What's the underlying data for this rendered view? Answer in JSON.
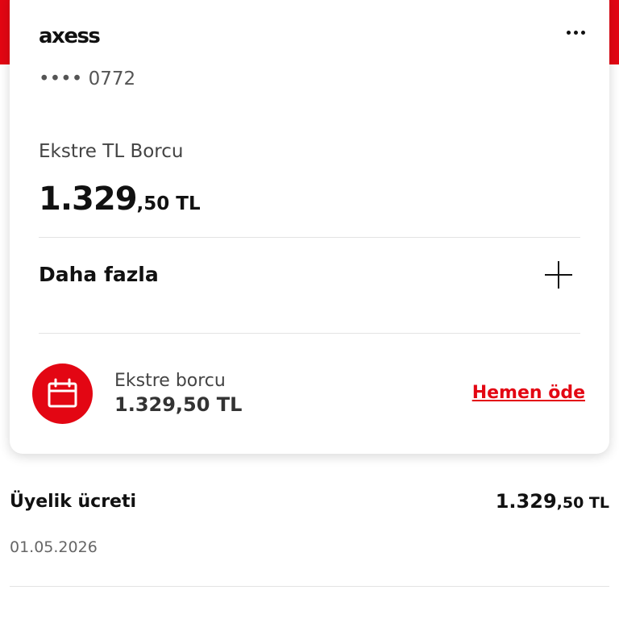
{
  "card": {
    "brand": "axess",
    "menu_icon": "more-dots-icon",
    "number": "•••• 0772",
    "debt_label": "Ekstre TL Borcu",
    "debt_main": "1.329",
    "debt_sub": ",50 TL",
    "more_label": "Daha fazla",
    "expand_icon": "plus-icon"
  },
  "payment": {
    "icon": "calendar-icon",
    "label": "Ekstre borcu",
    "amount": "1.329,50 TL",
    "link": "Hemen öde"
  },
  "transaction": {
    "title": "Üyelik ücreti",
    "amount_main": "1.329",
    "amount_sub": ",50 TL",
    "date": "01.05.2026"
  },
  "colors": {
    "brand_red": "#e30613",
    "text_dark": "#111111",
    "text_muted": "#666666"
  }
}
